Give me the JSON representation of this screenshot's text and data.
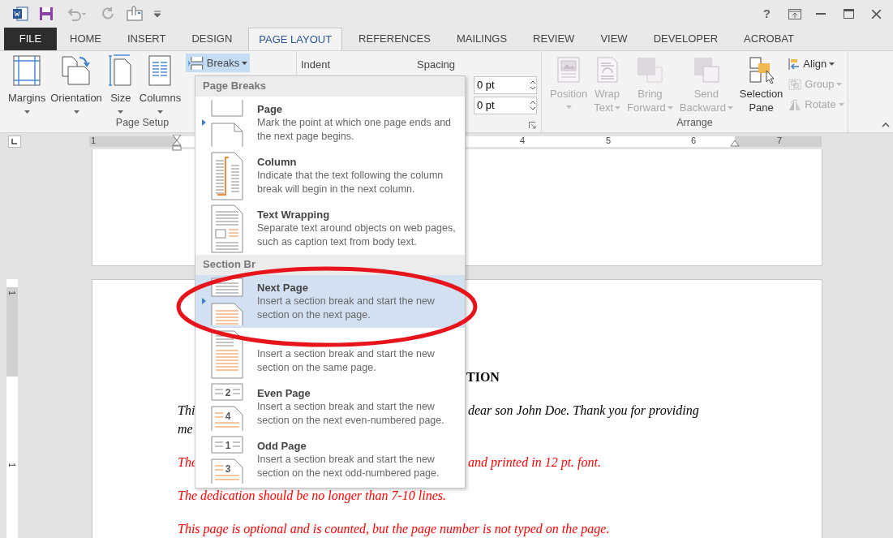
{
  "window": {
    "help": "?"
  },
  "file_tab": {
    "label": "FILE"
  },
  "tabs": [
    {
      "label": "HOME",
      "selected": false
    },
    {
      "label": "INSERT",
      "selected": false
    },
    {
      "label": "DESIGN",
      "selected": false
    },
    {
      "label": "PAGE LAYOUT",
      "selected": true
    },
    {
      "label": "REFERENCES",
      "selected": false
    },
    {
      "label": "MAILINGS",
      "selected": false
    },
    {
      "label": "REVIEW",
      "selected": false
    },
    {
      "label": "VIEW",
      "selected": false
    },
    {
      "label": "DEVELOPER",
      "selected": false
    },
    {
      "label": "ACROBAT",
      "selected": false
    }
  ],
  "page_setup": {
    "buttons": [
      {
        "label": "Margins"
      },
      {
        "label": "Orientation"
      },
      {
        "label": "Size"
      },
      {
        "label": "Columns"
      }
    ],
    "breaks": {
      "label": "Breaks",
      "expanded": true
    },
    "group_label": "Page Setup"
  },
  "paragraph": {
    "indent_label": "Indent",
    "spacing_label": "Spacing",
    "spacing_before": "0 pt",
    "spacing_after": "0 pt"
  },
  "arrange": {
    "buttons": [
      {
        "lines": [
          "Position"
        ],
        "disabled": true,
        "dropdown": true
      },
      {
        "lines": [
          "Wrap",
          "Text"
        ],
        "disabled": true,
        "dropdown": true
      },
      {
        "lines": [
          "Bring",
          "Forward"
        ],
        "disabled": true,
        "dropdown": true
      },
      {
        "lines": [
          "Send",
          "Backward"
        ],
        "disabled": true,
        "dropdown": true
      },
      {
        "lines": [
          "Selection",
          "Pane"
        ],
        "disabled": false,
        "dropdown": false
      }
    ],
    "small_buttons": [
      {
        "label": "Align",
        "disabled": false
      },
      {
        "label": "Group",
        "disabled": true
      },
      {
        "label": "Rotate",
        "disabled": true
      }
    ],
    "group_label": "Arrange"
  },
  "ruler": {
    "numbers": [
      "1",
      "4",
      "5",
      "6",
      "7"
    ]
  },
  "vertical_ruler": {
    "numbers": [
      "1",
      "1"
    ]
  },
  "breaks_menu": {
    "sections": [
      {
        "title": "Page Breaks",
        "items": [
          {
            "kind": "page",
            "label": "Page",
            "description": "Mark the point at which one page ends and the next page begins.",
            "selected": false,
            "default": true
          },
          {
            "kind": "column",
            "label": "Column",
            "description": "Indicate that the text following the column break will begin in the next column.",
            "selected": false,
            "default": false
          },
          {
            "kind": "text-wrapping",
            "label": "Text Wrapping",
            "description": "Separate text around objects on web pages, such as caption text from body text.",
            "selected": false,
            "default": false
          }
        ]
      },
      {
        "title": "Section Br",
        "items": [
          {
            "kind": "next-page",
            "label": "Next Page",
            "description": "Insert a section break and start the new section on the next page.",
            "selected": true,
            "default": true
          },
          {
            "kind": "continuous",
            "description": "Insert a section break and start the new section on the same page.",
            "selected": false,
            "default": false
          },
          {
            "kind": "even-page",
            "label": "Even Page",
            "description": "Insert a section break and start the new section on the next even-numbered page.",
            "selected": false,
            "default": false,
            "icon_numbers": [
              "2",
              "4"
            ]
          },
          {
            "kind": "odd-page",
            "label": "Odd Page",
            "description": "Insert a section break and start the new section on the next odd-numbered page.",
            "selected": false,
            "default": false,
            "icon_numbers": [
              "1",
              "3"
            ]
          }
        ]
      }
    ]
  },
  "document": {
    "paragraphs": [
      {
        "kind": "heading",
        "lines": [
          [
            "TION"
          ]
        ]
      },
      {
        "kind": "body",
        "lines": [
          [
            "Thi",
            "dear son John Doe. Thank you for providing"
          ],
          [
            "me"
          ]
        ]
      },
      {
        "kind": "note",
        "lines": [
          [
            "The",
            "and printed in 12 pt. font."
          ]
        ]
      },
      {
        "kind": "note",
        "lines": [
          [
            "The dedication should be no longer than 7-10 lines."
          ]
        ]
      },
      {
        "kind": "note",
        "lines": [
          [
            "This page is optional and is counted, but the page number is not typed on the page."
          ]
        ]
      }
    ]
  }
}
